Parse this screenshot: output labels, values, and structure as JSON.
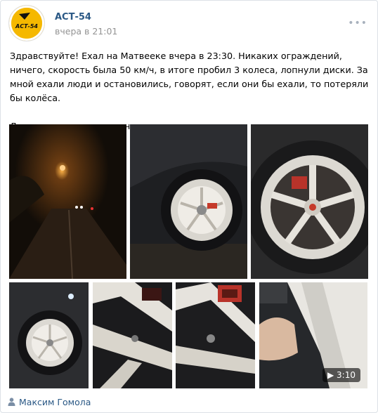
{
  "post": {
    "author": "АСТ-54",
    "time": "вчера в 21:01",
    "paragraphs": [
      "Здравствуйте! Ехал на Матвеeке вчера в 23:30. Никаких ограждений, ничего, скорость была 50 км/ч, в итоге пробил 3 колеса, лопнули диски. За мной ехали люди и остановились, говорят, если они бы ехали, то потеряли бы колёса.",
      "Дорожники выкопали и не оградили, а люди едут и проваливаются."
    ],
    "logo_text": "АСТ-54",
    "video_duration": "3:10",
    "signature": "Максим Гомола"
  },
  "colors": {
    "link": "#2a5885",
    "meta": "#939393",
    "logo_yellow": "#f5b800"
  },
  "icons": {
    "more": "more-icon",
    "play": "play-icon",
    "person": "person-icon"
  }
}
